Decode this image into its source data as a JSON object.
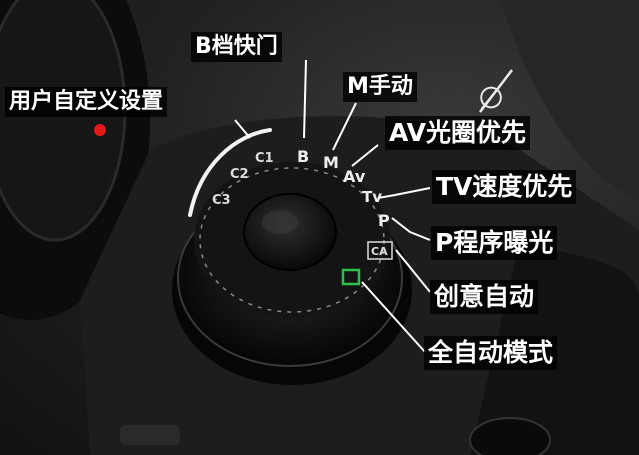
{
  "labels": {
    "b_shutter": "B档快门",
    "custom": "用户自定义设置",
    "m_manual": "M手动",
    "av": "AV光圈优先",
    "tv": "TV速度优先",
    "p": "P程序曝光",
    "ca": "创意自动",
    "auto": "全自动模式"
  },
  "dial": {
    "c1": "C1",
    "c2": "C2",
    "c3": "C3",
    "b": "B",
    "m": "M",
    "av": "Av",
    "tv": "Tv",
    "p": "P",
    "ca": "CA"
  },
  "diameter_symbol": "∅",
  "colors": {
    "auto_square": "#2fbf4a",
    "leader": "#ffffff",
    "label_bg": "#000000"
  }
}
